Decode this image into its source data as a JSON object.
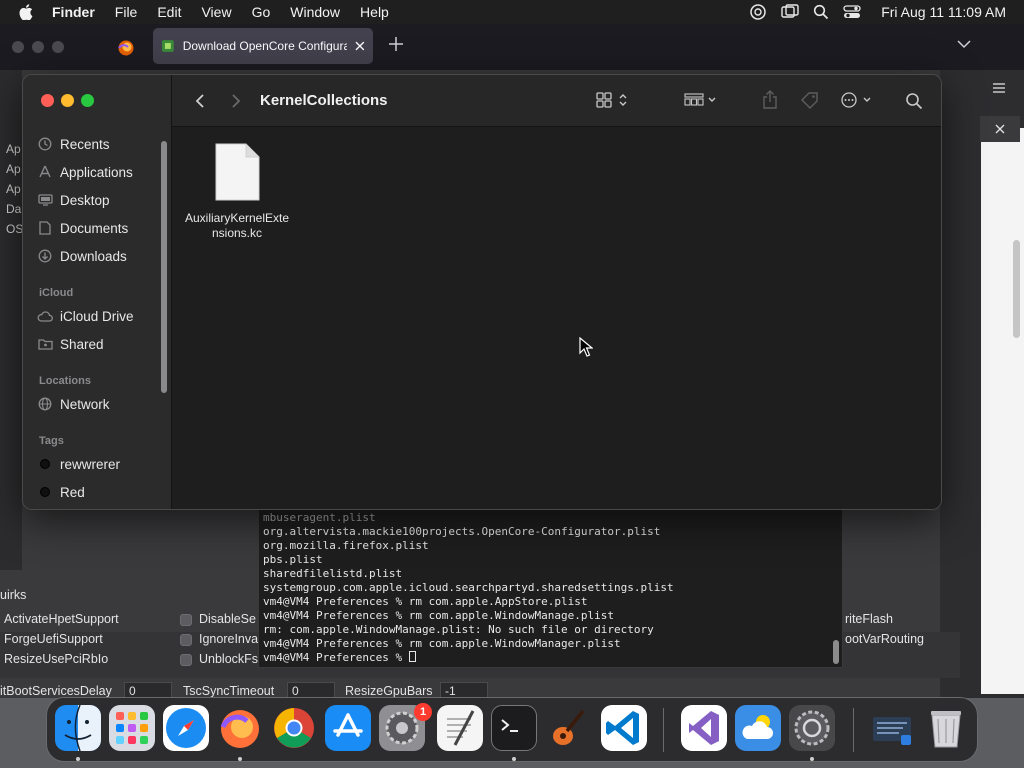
{
  "menubar": {
    "app": "Finder",
    "items": [
      "File",
      "Edit",
      "View",
      "Go",
      "Window",
      "Help"
    ],
    "clock": "Fri Aug 11  11:09 AM"
  },
  "firefox": {
    "tab_title": "Download OpenCore Configurat"
  },
  "configurator": {
    "left_items": [
      "Ap",
      "Ap",
      "Ap",
      "Da",
      "OS"
    ],
    "quirks_label": "uirks",
    "options": [
      "ActivateHpetSupport",
      "ForgeUefiSupport",
      "ResizeUsePciRbIo",
      "DisableSe",
      "IgnoreInva",
      "UnblockFs",
      "riteFlash",
      "ootVarRouting"
    ],
    "fields": [
      {
        "label": "itBootServicesDelay",
        "value": "0"
      },
      {
        "label": "TscSyncTimeout",
        "value": "0"
      },
      {
        "label": "ResizeGpuBars",
        "value": "-1"
      }
    ]
  },
  "terminal": {
    "lines": [
      "mbuseragent.plist",
      "org.altervista.mackie100projects.OpenCore-Configurator.plist",
      "org.mozilla.firefox.plist",
      "pbs.plist",
      "sharedfilelistd.plist",
      "systemgroup.com.apple.icloud.searchpartyd.sharedsettings.plist",
      "vm4@VM4 Preferences % rm com.apple.AppStore.plist",
      "vm4@VM4 Preferences % rm com.apple.WindowManage.plist",
      "rm: com.apple.WindowManage.plist: No such file or directory",
      "vm4@VM4 Preferences % rm com.apple.WindowManager.plist"
    ],
    "prompt": "vm4@VM4 Preferences % "
  },
  "finder": {
    "folder_title": "KernelCollections",
    "sidebar": {
      "favorites": [
        {
          "label": "Recents",
          "icon": "clock-icon"
        },
        {
          "label": "Applications",
          "icon": "applications-icon"
        },
        {
          "label": "Desktop",
          "icon": "desktop-icon"
        },
        {
          "label": "Documents",
          "icon": "document-icon"
        },
        {
          "label": "Downloads",
          "icon": "download-icon"
        }
      ],
      "icloud_header": "iCloud",
      "icloud": [
        {
          "label": "iCloud Drive",
          "icon": "cloud-icon"
        },
        {
          "label": "Shared",
          "icon": "shared-folder-icon"
        }
      ],
      "locations_header": "Locations",
      "locations": [
        {
          "label": "Network",
          "icon": "globe-icon"
        }
      ],
      "tags_header": "Tags",
      "tags": [
        {
          "label": "rewwrerer",
          "color": "#1a1a1a"
        },
        {
          "label": "Red",
          "color": "#1a1a1a"
        }
      ]
    },
    "files": [
      {
        "name": "AuxiliaryKernelExtensions.kc",
        "name_display": "AuxiliaryKernelExt\nensions.kc",
        "icon": "generic-file-icon"
      }
    ]
  },
  "dock": {
    "badge": "1",
    "apps": [
      "Finder",
      "Launchpad",
      "Safari",
      "Firefox",
      "Chrome",
      "App Store",
      "System Preferences",
      "TextEdit",
      "Terminal",
      "GarageBand",
      "Visual Studio Code",
      "Visual Studio",
      "iCloud Weather",
      "Settings",
      "Screenshot",
      "Trash"
    ]
  },
  "colors": {
    "traffic_red": "#ff5f57",
    "traffic_yellow": "#febc2e",
    "traffic_green": "#28c840",
    "badge_red": "#ff3b30"
  }
}
